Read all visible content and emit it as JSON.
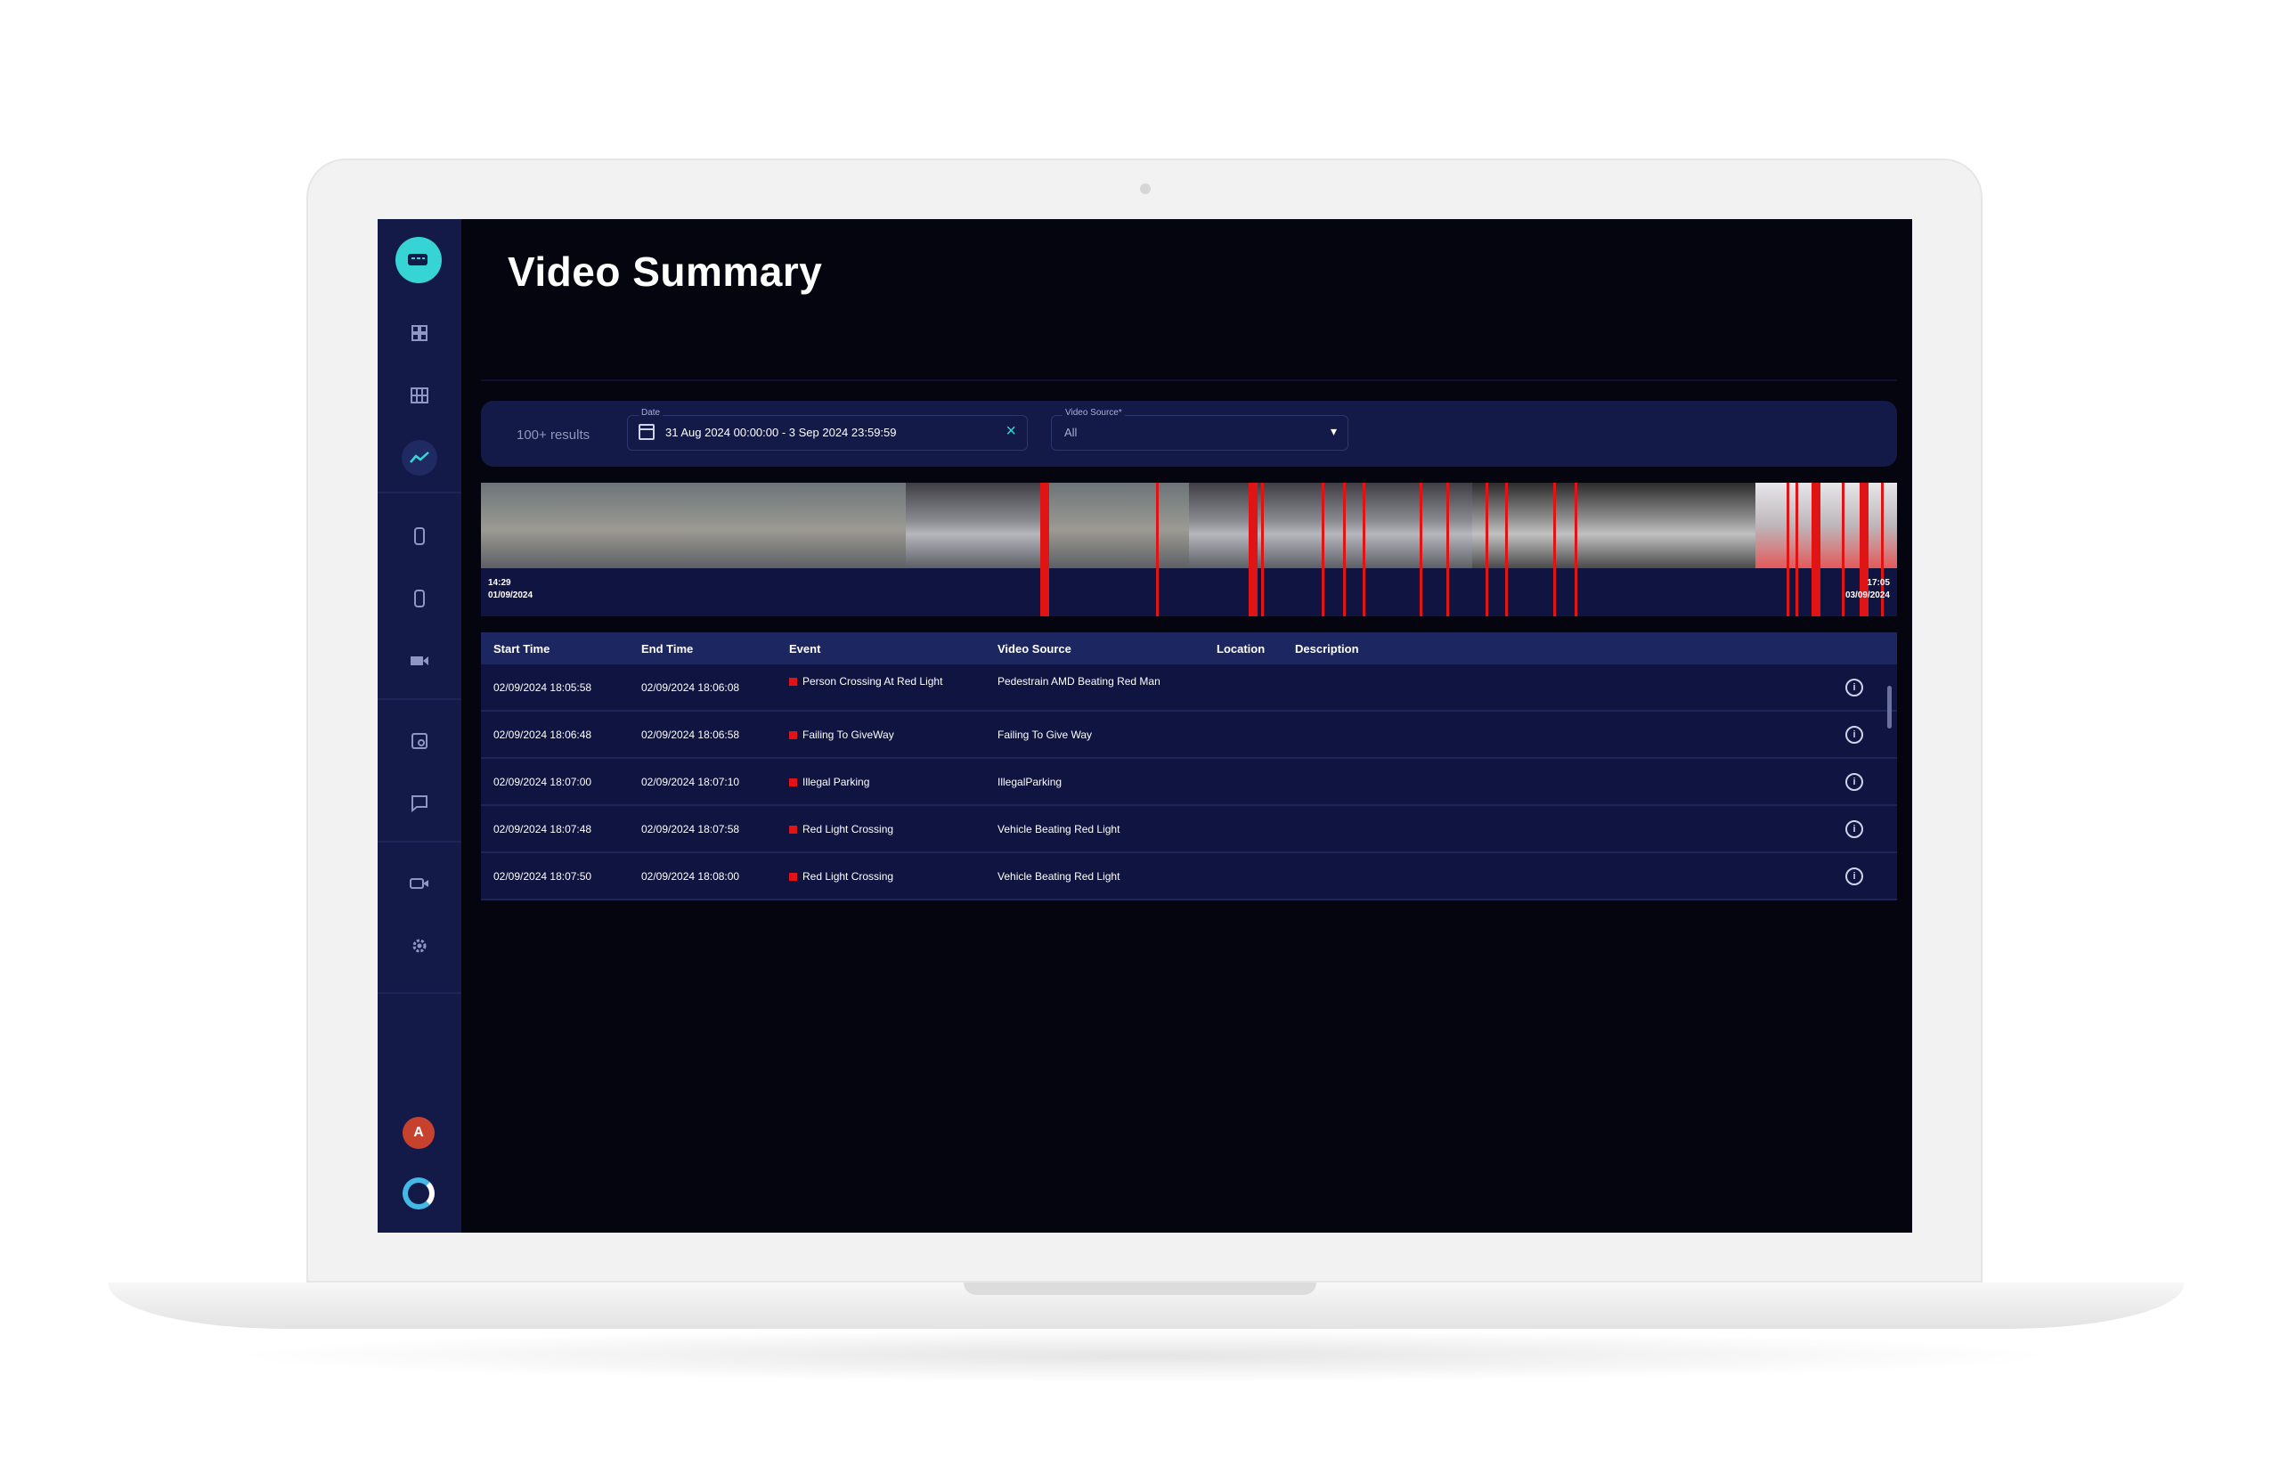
{
  "page": {
    "title": "Video Summary"
  },
  "filters": {
    "results_count": "100+ results",
    "date_label": "Date",
    "date_value": "31 Aug 2024 00:00:00 - 3 Sep 2024 23:59:59",
    "source_label": "Video Source*",
    "source_value": "All"
  },
  "timeline": {
    "start_time": "14:29",
    "start_date": "01/09/2024",
    "end_time": "17:05",
    "end_date": "03/09/2024"
  },
  "table": {
    "headers": {
      "start_time": "Start Time",
      "end_time": "End Time",
      "event": "Event",
      "video_source": "Video Source",
      "location": "Location",
      "description": "Description"
    },
    "rows": [
      {
        "start": "02/09/2024 18:05:58",
        "end": "02/09/2024 18:06:08",
        "event": "Person Crossing At Red Light",
        "source": "Pedestrain AMD Beating Red Man"
      },
      {
        "start": "02/09/2024 18:06:48",
        "end": "02/09/2024 18:06:58",
        "event": "Failing To GiveWay",
        "source": "Failing To Give Way"
      },
      {
        "start": "02/09/2024 18:07:00",
        "end": "02/09/2024 18:07:10",
        "event": "Illegal Parking",
        "source": "IllegalParking"
      },
      {
        "start": "02/09/2024 18:07:48",
        "end": "02/09/2024 18:07:58",
        "event": "Red Light Crossing",
        "source": "Vehicle Beating Red Light"
      },
      {
        "start": "02/09/2024 18:07:50",
        "end": "02/09/2024 18:08:00",
        "event": "Red Light Crossing",
        "source": "Vehicle Beating Red Light"
      }
    ]
  },
  "sidebar": {
    "avatar_initial": "A",
    "icons": [
      "camera-logo-icon",
      "dashboard-icon",
      "grid-icon",
      "analytics-icon",
      "device-icon",
      "device-alt-icon",
      "video-icon",
      "report-icon",
      "message-icon",
      "camera-icon",
      "settings-icon"
    ]
  },
  "colors": {
    "sidebar": "#131a47",
    "background": "#05050f",
    "accent": "#36d4d4",
    "event_marker": "#e01414"
  }
}
